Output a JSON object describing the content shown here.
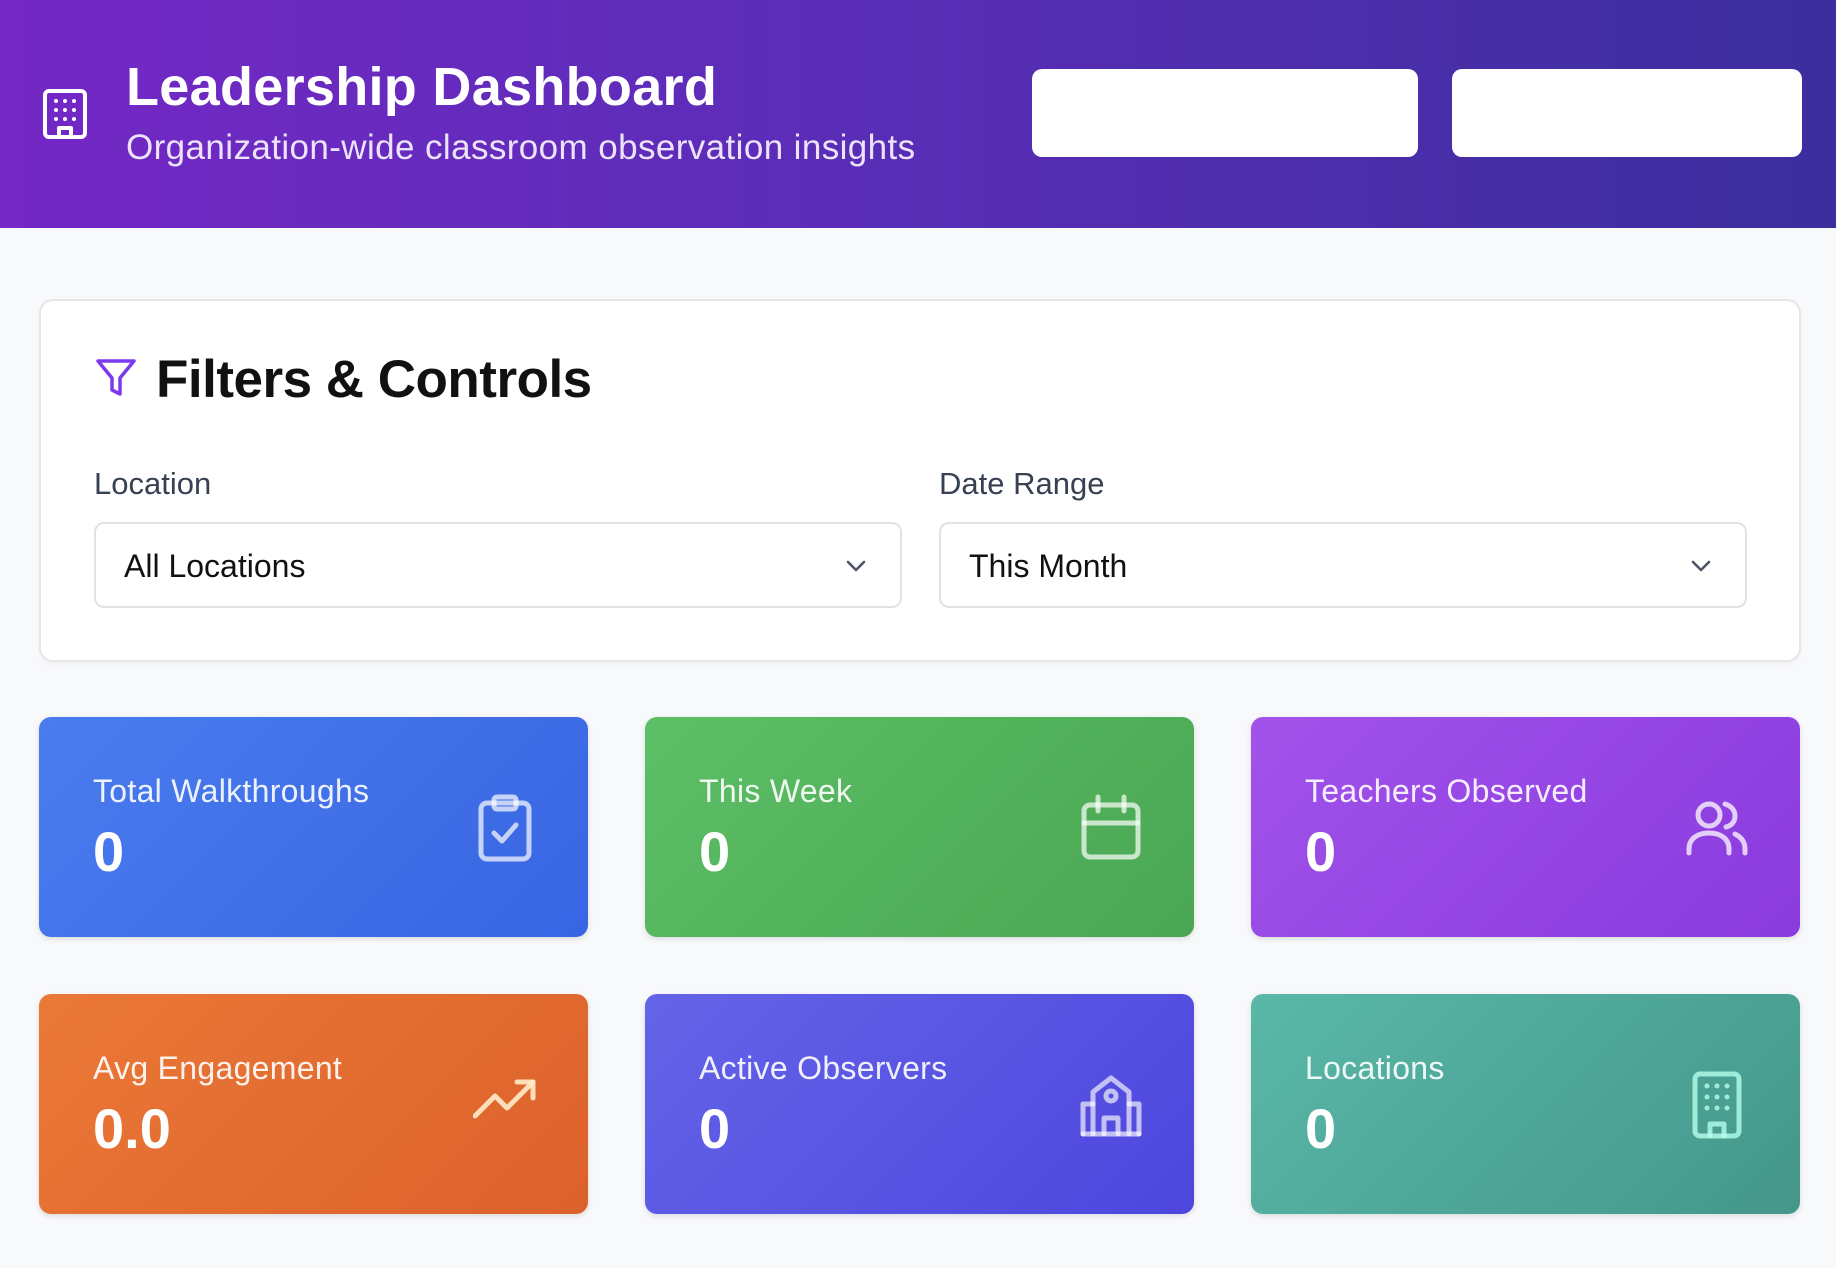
{
  "header": {
    "title": "Leadership Dashboard",
    "subtitle": "Organization-wide classroom observation insights",
    "logo_icon": "building-icon",
    "gradient_colors": [
      "#7428c5",
      "#3c2e9e"
    ],
    "action_buttons": [
      {
        "label": ""
      },
      {
        "label": ""
      }
    ]
  },
  "filters": {
    "title": "Filters & Controls",
    "icon": "filter-icon",
    "accent": "#7c3aed",
    "location": {
      "label": "Location",
      "value": "All Locations"
    },
    "date_range": {
      "label": "Date Range",
      "value": "This Month"
    }
  },
  "stats": [
    {
      "label": "Total Walkthroughs",
      "value": "0",
      "icon": "clipboard-check-icon",
      "color": "#4272ea"
    },
    {
      "label": "This Week",
      "value": "0",
      "icon": "calendar-icon",
      "color": "#53b35d"
    },
    {
      "label": "Teachers Observed",
      "value": "0",
      "icon": "users-icon",
      "color": "#9646e4"
    },
    {
      "label": "Avg Engagement",
      "value": "0.0",
      "icon": "trending-up-icon",
      "color": "#e36c31"
    },
    {
      "label": "Active Observers",
      "value": "0",
      "icon": "school-icon",
      "color": "#5a55e2"
    },
    {
      "label": "Locations",
      "value": "0",
      "icon": "building-icon",
      "color": "#4fa899"
    }
  ]
}
